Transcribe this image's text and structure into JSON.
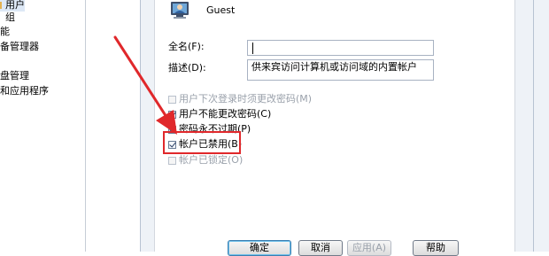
{
  "tree": {
    "items": [
      {
        "label": "用户",
        "selected": true
      },
      {
        "label": "组",
        "selected": false
      },
      {
        "label": "能",
        "selected": false
      },
      {
        "label": "备管理器",
        "selected": false
      },
      {
        "label": "盘管理",
        "selected": false
      },
      {
        "label": "和应用程序",
        "selected": false
      }
    ]
  },
  "dialog": {
    "user_name": "Guest",
    "fullname_label": "全名(F):",
    "fullname_value": "",
    "description_label": "描述(D):",
    "description_value": "供来宾访问计算机或访问域的内置帐户"
  },
  "checkboxes": [
    {
      "label": "用户下次登录时须更改密码(M)",
      "checked": false,
      "disabled": true
    },
    {
      "label": "用户不能更改密码(C)",
      "checked": true,
      "disabled": false
    },
    {
      "label": "密码永不过期(P)",
      "checked": true,
      "disabled": false
    },
    {
      "label": "帐户已禁用(B)",
      "checked": true,
      "disabled": false
    },
    {
      "label": "帐户已锁定(O)",
      "checked": false,
      "disabled": true
    }
  ],
  "buttons": {
    "ok": "确定",
    "cancel": "取消",
    "apply": "应用(A)",
    "help": "帮助"
  },
  "annotation": {
    "highlight_color": "#e0282b",
    "arrow_color": "#e0282b"
  },
  "icons": [
    "user-account-icon",
    "red-arrow-icon"
  ]
}
